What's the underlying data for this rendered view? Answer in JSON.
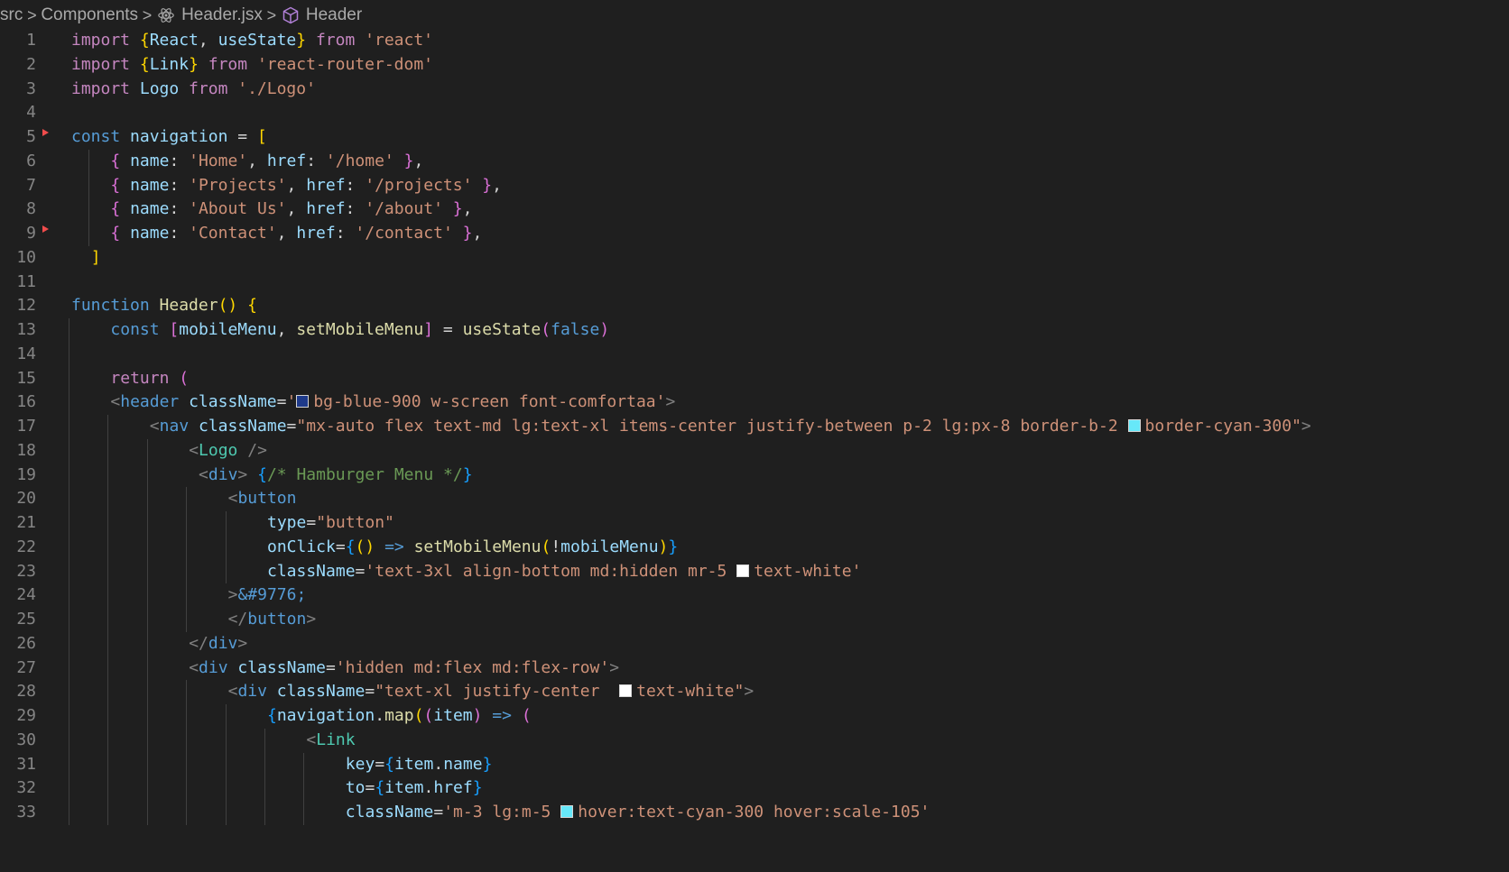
{
  "breadcrumb": {
    "items": [
      {
        "label": "src",
        "icon": null
      },
      {
        "label": "Components",
        "icon": null
      },
      {
        "label": "Header.jsx",
        "icon": "react-icon"
      },
      {
        "label": "Header",
        "icon": "symbol-method-icon"
      }
    ],
    "separator": ">"
  },
  "swatch_colors": {
    "bg-blue-900": "#1e3a8a",
    "border-cyan-300": "#67e8f9",
    "text-white": "#ffffff",
    "hover:text-cyan-300": "#67e8f9"
  },
  "gutter_markers": [
    5,
    9
  ],
  "lines": [
    {
      "n": 1,
      "indent": 0,
      "tokens": [
        [
          "k",
          "import "
        ],
        [
          "b1",
          "{"
        ],
        [
          "v",
          "React"
        ],
        [
          "p",
          ", "
        ],
        [
          "v",
          "useState"
        ],
        [
          "b1",
          "}"
        ],
        [
          "k",
          " from "
        ],
        [
          "st",
          "'react'"
        ]
      ]
    },
    {
      "n": 2,
      "indent": 0,
      "tokens": [
        [
          "k",
          "import "
        ],
        [
          "b1",
          "{"
        ],
        [
          "v",
          "Link"
        ],
        [
          "b1",
          "}"
        ],
        [
          "k",
          " from "
        ],
        [
          "st",
          "'react-router-dom'"
        ]
      ]
    },
    {
      "n": 3,
      "indent": 0,
      "tokens": [
        [
          "k",
          "import "
        ],
        [
          "v",
          "Logo"
        ],
        [
          "k",
          " from "
        ],
        [
          "st",
          "'./Logo'"
        ]
      ]
    },
    {
      "n": 4,
      "indent": 0,
      "tokens": []
    },
    {
      "n": 5,
      "indent": 0,
      "tokens": [
        [
          "s",
          "const "
        ],
        [
          "v",
          "navigation"
        ],
        [
          "p",
          " = "
        ],
        [
          "b1",
          "["
        ]
      ]
    },
    {
      "n": 6,
      "indent": 4,
      "tokens": [
        [
          "b2",
          "{ "
        ],
        [
          "v",
          "name"
        ],
        [
          "p",
          ": "
        ],
        [
          "st",
          "'Home'"
        ],
        [
          "p",
          ", "
        ],
        [
          "v",
          "href"
        ],
        [
          "p",
          ": "
        ],
        [
          "st",
          "'/home'"
        ],
        [
          "b2",
          " }"
        ],
        [
          "p",
          ","
        ]
      ]
    },
    {
      "n": 7,
      "indent": 4,
      "tokens": [
        [
          "b2",
          "{ "
        ],
        [
          "v",
          "name"
        ],
        [
          "p",
          ": "
        ],
        [
          "st",
          "'Projects'"
        ],
        [
          "p",
          ", "
        ],
        [
          "v",
          "href"
        ],
        [
          "p",
          ": "
        ],
        [
          "st",
          "'/projects'"
        ],
        [
          "b2",
          " }"
        ],
        [
          "p",
          ","
        ]
      ]
    },
    {
      "n": 8,
      "indent": 4,
      "tokens": [
        [
          "b2",
          "{ "
        ],
        [
          "v",
          "name"
        ],
        [
          "p",
          ": "
        ],
        [
          "st",
          "'About Us'"
        ],
        [
          "p",
          ", "
        ],
        [
          "v",
          "href"
        ],
        [
          "p",
          ": "
        ],
        [
          "st",
          "'/about'"
        ],
        [
          "b2",
          " }"
        ],
        [
          "p",
          ","
        ]
      ]
    },
    {
      "n": 9,
      "indent": 4,
      "tokens": [
        [
          "b2",
          "{ "
        ],
        [
          "v",
          "name"
        ],
        [
          "p",
          ": "
        ],
        [
          "st",
          "'Contact'"
        ],
        [
          "p",
          ", "
        ],
        [
          "v",
          "href"
        ],
        [
          "p",
          ": "
        ],
        [
          "st",
          "'/contact'"
        ],
        [
          "b2",
          " }"
        ],
        [
          "p",
          ","
        ]
      ]
    },
    {
      "n": 10,
      "indent": 2,
      "tokens": [
        [
          "b1",
          "]"
        ]
      ]
    },
    {
      "n": 11,
      "indent": 0,
      "tokens": []
    },
    {
      "n": 12,
      "indent": 0,
      "tokens": [
        [
          "s",
          "function "
        ],
        [
          "f",
          "Header"
        ],
        [
          "b1",
          "() {"
        ]
      ]
    },
    {
      "n": 13,
      "indent": 4,
      "tokens": [
        [
          "s",
          "const "
        ],
        [
          "b2",
          "["
        ],
        [
          "v",
          "mobileMenu"
        ],
        [
          "p",
          ", "
        ],
        [
          "f",
          "setMobileMenu"
        ],
        [
          "b2",
          "]"
        ],
        [
          "p",
          " = "
        ],
        [
          "f",
          "useState"
        ],
        [
          "b2",
          "("
        ],
        [
          "s",
          "false"
        ],
        [
          "b2",
          ")"
        ]
      ]
    },
    {
      "n": 14,
      "indent": 0,
      "tokens": []
    },
    {
      "n": 15,
      "indent": 4,
      "tokens": [
        [
          "k",
          "return "
        ],
        [
          "b2",
          "("
        ]
      ]
    },
    {
      "n": 16,
      "indent": 4,
      "tokens": [
        [
          "g",
          "<"
        ],
        [
          "s",
          "header "
        ],
        [
          "a",
          "className"
        ],
        [
          "p",
          "="
        ],
        [
          "st",
          "'"
        ],
        [
          "sw",
          "bg-blue-900"
        ],
        [
          "st",
          "bg-blue-900 w-screen font-comfortaa'"
        ],
        [
          "g",
          ">"
        ]
      ]
    },
    {
      "n": 17,
      "indent": 8,
      "tokens": [
        [
          "g",
          "<"
        ],
        [
          "s",
          "nav "
        ],
        [
          "a",
          "className"
        ],
        [
          "p",
          "="
        ],
        [
          "st",
          "\"mx-auto flex text-md lg:text-xl items-center justify-between p-2 lg:px-8 border-b-2 "
        ],
        [
          "sw",
          "border-cyan-300"
        ],
        [
          "st",
          "border-cyan-300\""
        ],
        [
          "g",
          ">"
        ]
      ]
    },
    {
      "n": 18,
      "indent": 12,
      "tokens": [
        [
          "g",
          "<"
        ],
        [
          "t",
          "Logo"
        ],
        [
          "g",
          " />"
        ]
      ]
    },
    {
      "n": 19,
      "indent": 13,
      "tokens": [
        [
          "g",
          "<"
        ],
        [
          "s",
          "div"
        ],
        [
          "g",
          "> "
        ],
        [
          "b3",
          "{"
        ],
        [
          "c",
          "/* Hamburger Menu */"
        ],
        [
          "b3",
          "}"
        ]
      ]
    },
    {
      "n": 20,
      "indent": 16,
      "tokens": [
        [
          "g",
          "<"
        ],
        [
          "s",
          "button"
        ]
      ]
    },
    {
      "n": 21,
      "indent": 20,
      "tokens": [
        [
          "a",
          "type"
        ],
        [
          "p",
          "="
        ],
        [
          "st",
          "\"button\""
        ]
      ]
    },
    {
      "n": 22,
      "indent": 20,
      "tokens": [
        [
          "a",
          "onClick"
        ],
        [
          "p",
          "="
        ],
        [
          "b3",
          "{"
        ],
        [
          "b1",
          "()"
        ],
        [
          "s",
          " => "
        ],
        [
          "f",
          "setMobileMenu"
        ],
        [
          "b1",
          "("
        ],
        [
          "p",
          "!"
        ],
        [
          "v",
          "mobileMenu"
        ],
        [
          "b1",
          ")"
        ],
        [
          "b3",
          "}"
        ]
      ]
    },
    {
      "n": 23,
      "indent": 20,
      "tokens": [
        [
          "a",
          "className"
        ],
        [
          "p",
          "="
        ],
        [
          "st",
          "'text-3xl align-bottom md:hidden mr-5 "
        ],
        [
          "sw",
          "text-white"
        ],
        [
          "st",
          "text-white'"
        ]
      ]
    },
    {
      "n": 24,
      "indent": 16,
      "tokens": [
        [
          "g",
          ">"
        ],
        [
          "s",
          "&#9776;"
        ]
      ]
    },
    {
      "n": 25,
      "indent": 16,
      "tokens": [
        [
          "g",
          "</"
        ],
        [
          "s",
          "button"
        ],
        [
          "g",
          ">"
        ]
      ]
    },
    {
      "n": 26,
      "indent": 12,
      "tokens": [
        [
          "g",
          "</"
        ],
        [
          "s",
          "div"
        ],
        [
          "g",
          ">"
        ]
      ]
    },
    {
      "n": 27,
      "indent": 12,
      "tokens": [
        [
          "g",
          "<"
        ],
        [
          "s",
          "div "
        ],
        [
          "a",
          "className"
        ],
        [
          "p",
          "="
        ],
        [
          "st",
          "'hidden md:flex md:flex-row'"
        ],
        [
          "g",
          ">"
        ]
      ]
    },
    {
      "n": 28,
      "indent": 16,
      "tokens": [
        [
          "g",
          "<"
        ],
        [
          "s",
          "div "
        ],
        [
          "a",
          "className"
        ],
        [
          "p",
          "="
        ],
        [
          "st",
          "\"text-xl justify-center  "
        ],
        [
          "sw",
          "text-white"
        ],
        [
          "st",
          "text-white\""
        ],
        [
          "g",
          ">"
        ]
      ]
    },
    {
      "n": 29,
      "indent": 20,
      "tokens": [
        [
          "b3",
          "{"
        ],
        [
          "v",
          "navigation"
        ],
        [
          "p",
          "."
        ],
        [
          "f",
          "map"
        ],
        [
          "b1",
          "("
        ],
        [
          "b2",
          "("
        ],
        [
          "v",
          "item"
        ],
        [
          "b2",
          ")"
        ],
        [
          "s",
          " => "
        ],
        [
          "b2",
          "("
        ]
      ]
    },
    {
      "n": 30,
      "indent": 24,
      "tokens": [
        [
          "g",
          "<"
        ],
        [
          "t",
          "Link"
        ]
      ]
    },
    {
      "n": 31,
      "indent": 28,
      "tokens": [
        [
          "a",
          "key"
        ],
        [
          "p",
          "="
        ],
        [
          "b3",
          "{"
        ],
        [
          "v",
          "item"
        ],
        [
          "p",
          "."
        ],
        [
          "v",
          "name"
        ],
        [
          "b3",
          "}"
        ]
      ]
    },
    {
      "n": 32,
      "indent": 28,
      "tokens": [
        [
          "a",
          "to"
        ],
        [
          "p",
          "="
        ],
        [
          "b3",
          "{"
        ],
        [
          "v",
          "item"
        ],
        [
          "p",
          "."
        ],
        [
          "v",
          "href"
        ],
        [
          "b3",
          "}"
        ]
      ]
    },
    {
      "n": 33,
      "indent": 28,
      "tokens": [
        [
          "a",
          "className"
        ],
        [
          "p",
          "="
        ],
        [
          "st",
          "'m-3 lg:m-5 "
        ],
        [
          "sw",
          "hover:text-cyan-300"
        ],
        [
          "st",
          "hover:text-cyan-300 hover:scale-105'"
        ]
      ]
    }
  ],
  "guides": {
    "6": [
      2
    ],
    "7": [
      2
    ],
    "8": [
      2
    ],
    "9": [
      2
    ],
    "13": [
      0
    ],
    "14": [
      0
    ],
    "15": [
      0
    ],
    "16": [
      0
    ],
    "17": [
      0,
      4
    ],
    "18": [
      0,
      4,
      8
    ],
    "19": [
      0,
      4,
      8
    ],
    "20": [
      0,
      4,
      8,
      12
    ],
    "21": [
      0,
      4,
      8,
      12,
      16
    ],
    "22": [
      0,
      4,
      8,
      12,
      16
    ],
    "23": [
      0,
      4,
      8,
      12,
      16
    ],
    "24": [
      0,
      4,
      8,
      12
    ],
    "25": [
      0,
      4,
      8,
      12
    ],
    "26": [
      0,
      4,
      8
    ],
    "27": [
      0,
      4,
      8
    ],
    "28": [
      0,
      4,
      8,
      12
    ],
    "29": [
      0,
      4,
      8,
      12,
      16
    ],
    "30": [
      0,
      4,
      8,
      12,
      16,
      20
    ],
    "31": [
      0,
      4,
      8,
      12,
      16,
      20,
      24
    ],
    "32": [
      0,
      4,
      8,
      12,
      16,
      20,
      24
    ],
    "33": [
      0,
      4,
      8,
      12,
      16,
      20,
      24
    ]
  }
}
